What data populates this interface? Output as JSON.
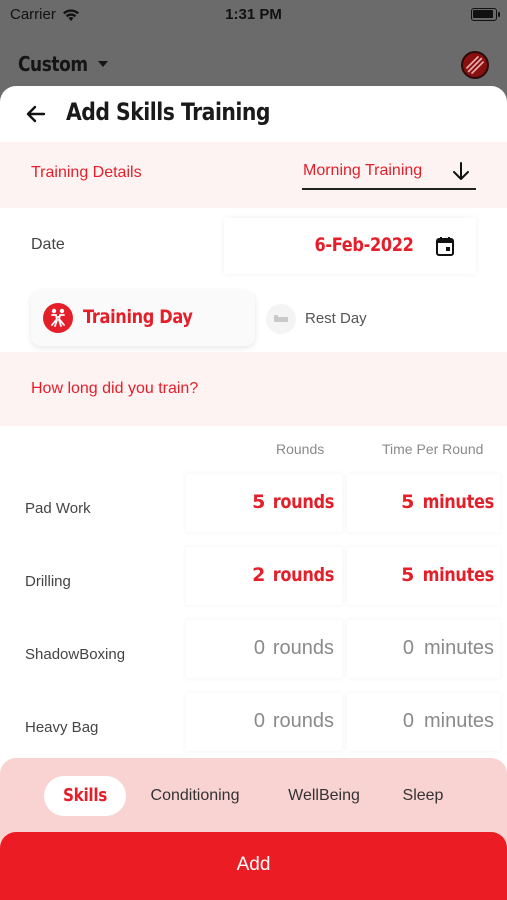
{
  "statusbar": {
    "carrier": "Carrier",
    "time": "1:31 PM"
  },
  "background_header": {
    "profile_label": "Custom"
  },
  "sheet": {
    "title": "Add Skills Training"
  },
  "training_details": {
    "label": "Training Details",
    "selected_session": "Morning Training"
  },
  "date": {
    "label": "Date",
    "value": "6-Feb-2022"
  },
  "day_type": {
    "training_day": "Training Day",
    "rest_day": "Rest Day",
    "selected": "Training Day"
  },
  "duration_prompt": "How long did you train?",
  "columns": {
    "rounds": "Rounds",
    "time_per_round": "Time Per Round"
  },
  "exercises": [
    {
      "name": "Pad Work",
      "rounds": "5",
      "rounds_unit": "rounds",
      "minutes": "5",
      "minutes_unit": "minutes"
    },
    {
      "name": "Drilling",
      "rounds": "2",
      "rounds_unit": "rounds",
      "minutes": "5",
      "minutes_unit": "minutes"
    },
    {
      "name": "ShadowBoxing",
      "rounds": "0",
      "rounds_unit": "rounds",
      "minutes": "0",
      "minutes_unit": "minutes"
    },
    {
      "name": "Heavy Bag",
      "rounds": "0",
      "rounds_unit": "rounds",
      "minutes": "0",
      "minutes_unit": "minutes"
    }
  ],
  "tabs": [
    {
      "label": "Skills",
      "active": true
    },
    {
      "label": "Conditioning",
      "active": false
    },
    {
      "label": "WellBeing",
      "active": false
    },
    {
      "label": "Sleep",
      "active": false
    }
  ],
  "add_button": "Add",
  "colors": {
    "accent": "#e41f2a",
    "tab_bar": "#f9d2d2",
    "section_tint": "#fdf3f3"
  }
}
